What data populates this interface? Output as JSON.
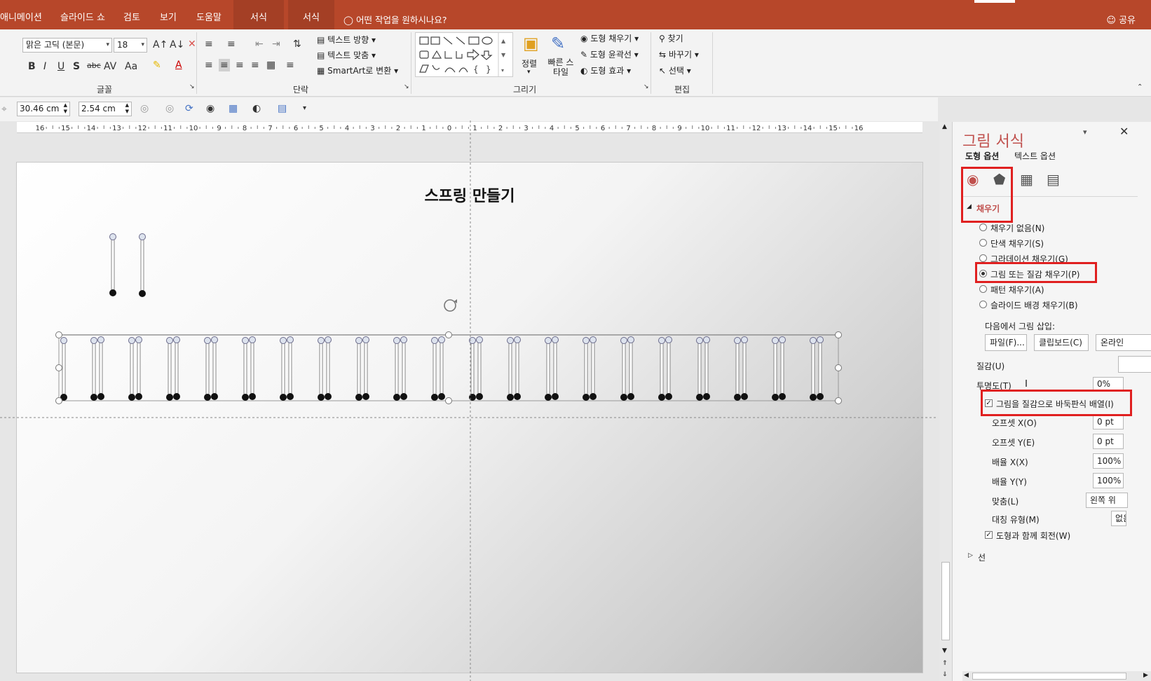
{
  "tabs": {
    "animations": "애니메이션",
    "slideshow": "슬라이드 쇼",
    "review": "검토",
    "view": "보기",
    "help": "도움말",
    "format1": "서식",
    "format2": "서식",
    "tellme": "어떤 작업을 원하시나요?",
    "share": "공유"
  },
  "ribbon": {
    "font_name": "맑은 고딕 (본문)",
    "font_size": "18",
    "text_direction": "텍스트 방향",
    "align_text": "텍스트 맞춤",
    "smartart": "SmartArt로 변환",
    "arrange": "정렬",
    "quick_styles": "빠른 스타일",
    "shape_fill": "도형 채우기",
    "shape_outline": "도형 윤곽선",
    "shape_effects": "도형 효과",
    "find": "찾기",
    "replace": "바꾸기",
    "select": "선택",
    "group_font": "글꼴",
    "group_paragraph": "단락",
    "group_drawing": "그리기",
    "group_editing": "편집"
  },
  "toolbar": {
    "width": "30.46 cm",
    "height": "2.54 cm"
  },
  "ruler": {
    "labels": [
      "16",
      "15",
      "14",
      "13",
      "12",
      "11",
      "10",
      "9",
      "8",
      "7",
      "6",
      "5",
      "4",
      "3",
      "2",
      "1",
      "0",
      "1",
      "2",
      "3",
      "4",
      "5",
      "6",
      "7",
      "8",
      "9",
      "10",
      "11",
      "12",
      "13",
      "14",
      "15",
      "16"
    ]
  },
  "slide": {
    "title": "스프링 만들기"
  },
  "pane": {
    "title": "그림 서식",
    "tab_shape": "도형 옵션",
    "tab_text": "텍스트 옵션",
    "section_fill": "채우기",
    "fill_none": "채우기 없음(N)",
    "fill_solid": "단색 채우기(S)",
    "fill_gradient": "그라데이션 채우기(G)",
    "fill_picture": "그림 또는 질감 채우기(P)",
    "fill_pattern": "패턴 채우기(A)",
    "fill_slide_bg": "슬라이드 배경 채우기(B)",
    "insert_from": "다음에서 그림 삽입:",
    "btn_file": "파일(F)...",
    "btn_clipboard": "클립보드(C)",
    "btn_online": "온라인",
    "texture": "질감(U)",
    "transparency": "투명도(T)",
    "transparency_value": "0%",
    "tile": "그림을 질감으로 바둑판식 배열(I)",
    "offset_x": "오프셋 X(O)",
    "offset_x_value": "0 pt",
    "offset_y": "오프셋 Y(E)",
    "offset_y_value": "0 pt",
    "scale_x": "배율 X(X)",
    "scale_x_value": "100%",
    "scale_y": "배율 Y(Y)",
    "scale_y_value": "100%",
    "alignment": "맞춤(L)",
    "alignment_value": "왼쪽 위",
    "mirror": "대칭 유형(M)",
    "mirror_value": "없음",
    "rotate_with_shape": "도형과 함께 회전(W)",
    "section_line": "선"
  }
}
